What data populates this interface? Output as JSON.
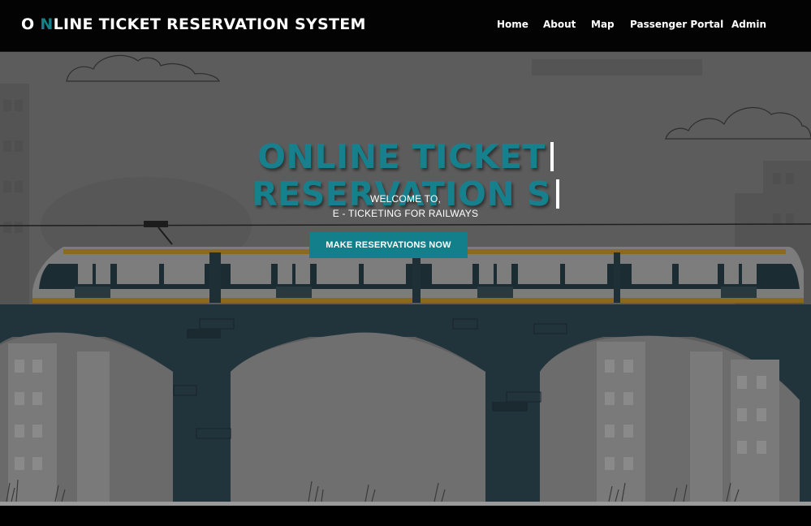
{
  "brand": {
    "pre": "O ",
    "accent": "N",
    "post": "LINE TICKET RESERVATION SYSTEM"
  },
  "nav": {
    "items": [
      {
        "label": "Home"
      },
      {
        "label": "About"
      },
      {
        "label": "Map"
      },
      {
        "label": "Passenger Portal"
      },
      {
        "label": "Admin"
      }
    ]
  },
  "hero": {
    "title_line1": "ONLINE TICKET",
    "title_line2": "RESERVATION S",
    "welcome_line1": "WELCOME TO,",
    "welcome_line2": "E - TICKETING FOR RAILWAYS",
    "cta_label": "MAKE RESERVATIONS NOW"
  },
  "colors": {
    "accent": "#17808d",
    "button": "#137f8a",
    "navbar": "#030303",
    "bridge": "#22343b",
    "train_stripe": "#8a6a1c"
  }
}
